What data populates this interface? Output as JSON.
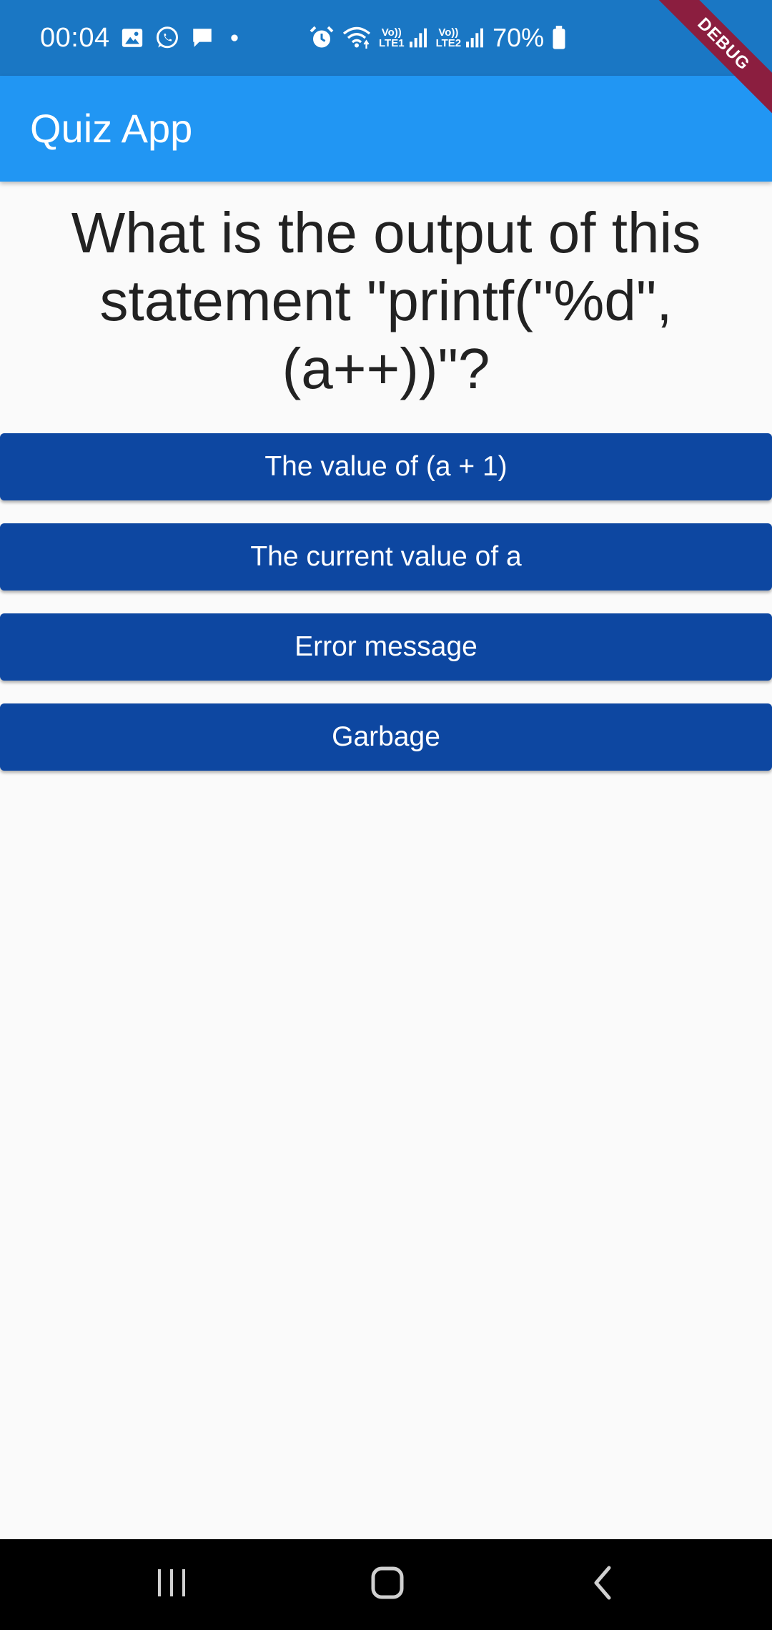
{
  "status_bar": {
    "time": "00:04",
    "left_icons": [
      "gallery-icon",
      "whatsapp-icon",
      "message-icon",
      "dot-icon"
    ],
    "right_icons": [
      "alarm-icon",
      "wifi-icon",
      "volte1-signal-icon",
      "volte2-signal-icon",
      "battery-icon"
    ],
    "sim1_label_top": "Vo))",
    "sim1_label_bottom": "LTE1",
    "sim2_label_top": "Vo))",
    "sim2_label_bottom": "LTE2",
    "battery": "70%"
  },
  "debug_banner": "DEBUG",
  "app_bar": {
    "title": "Quiz App"
  },
  "question": "What is the output of this statement \"printf(\"%d\", (a++))\"?",
  "answers": [
    "The value of (a + 1)",
    "The current value of a",
    "Error message",
    "Garbage"
  ],
  "nav_bar": {
    "buttons": [
      "recent-apps-icon",
      "home-icon",
      "back-icon"
    ]
  },
  "colors": {
    "status_bar": "#1a77c4",
    "app_bar": "#2196f3",
    "button": "#0d47a1",
    "background": "#fafafa",
    "debug": "#8b1e3f"
  }
}
